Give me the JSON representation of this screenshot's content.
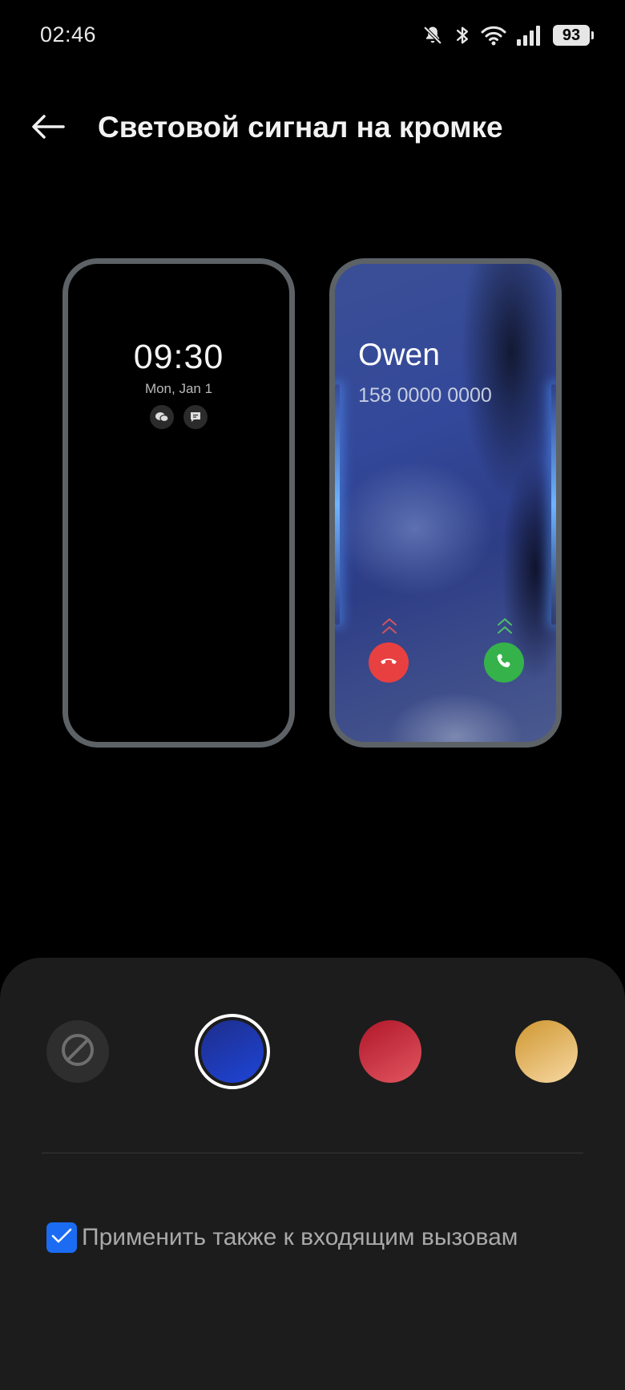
{
  "status_bar": {
    "time": "02:46",
    "battery": "93",
    "icons": [
      "bell-off-icon",
      "bluetooth-icon",
      "wifi-icon",
      "cellular-signal-icon",
      "battery-icon"
    ]
  },
  "header": {
    "back_icon": "arrow-left-icon",
    "title": "Световой сигнал на кромке"
  },
  "preview_aod": {
    "time": "09:30",
    "date": "Mon, Jan 1",
    "notification_icons": [
      "wechat-icon",
      "message-icon"
    ]
  },
  "preview_call": {
    "caller_name": "Owen",
    "caller_number": "158 0000 0000",
    "glow_color": "#5aa7ff",
    "decline_color": "#e84040",
    "accept_color": "#35b24a"
  },
  "colors": {
    "options": [
      {
        "id": "none",
        "icon": "prohibited-icon",
        "selected": false
      },
      {
        "id": "blue",
        "color": "#1f45d8",
        "selected": true
      },
      {
        "id": "red",
        "color": "#d43a48",
        "selected": false
      },
      {
        "id": "gold",
        "color": "#e9b868",
        "selected": false
      }
    ]
  },
  "apply_option": {
    "label": "Применить также к входящим вызовам",
    "checked": true,
    "accent": "#1b6cf2"
  }
}
